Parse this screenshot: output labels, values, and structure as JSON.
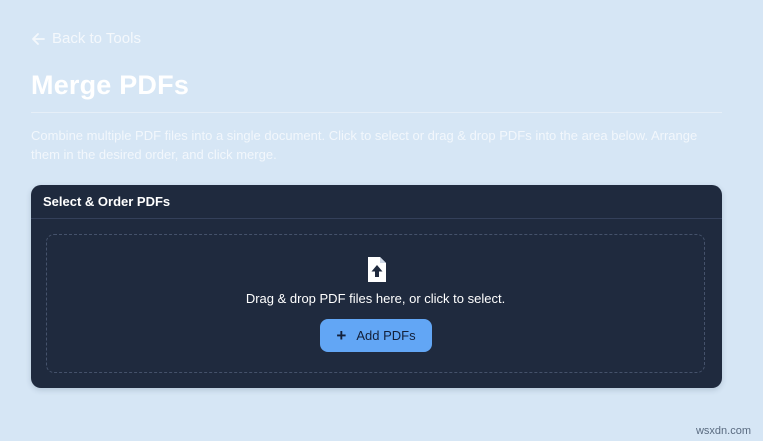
{
  "nav": {
    "back_label": "Back to Tools"
  },
  "page": {
    "title": "Merge PDFs",
    "description": "Combine multiple PDF files into a single document. Click to select or drag & drop PDFs into the area below. Arrange them in the desired order, and click merge."
  },
  "card": {
    "header": "Select & Order PDFs",
    "dropzone_text": "Drag & drop PDF files here, or click to select.",
    "add_button_label": "Add PDFs",
    "icon": "file-upload-icon"
  },
  "watermark": "wsxdn.com",
  "colors": {
    "background": "#d6e6f5",
    "card": "#1f2a3e",
    "accent": "#62a6f5"
  }
}
